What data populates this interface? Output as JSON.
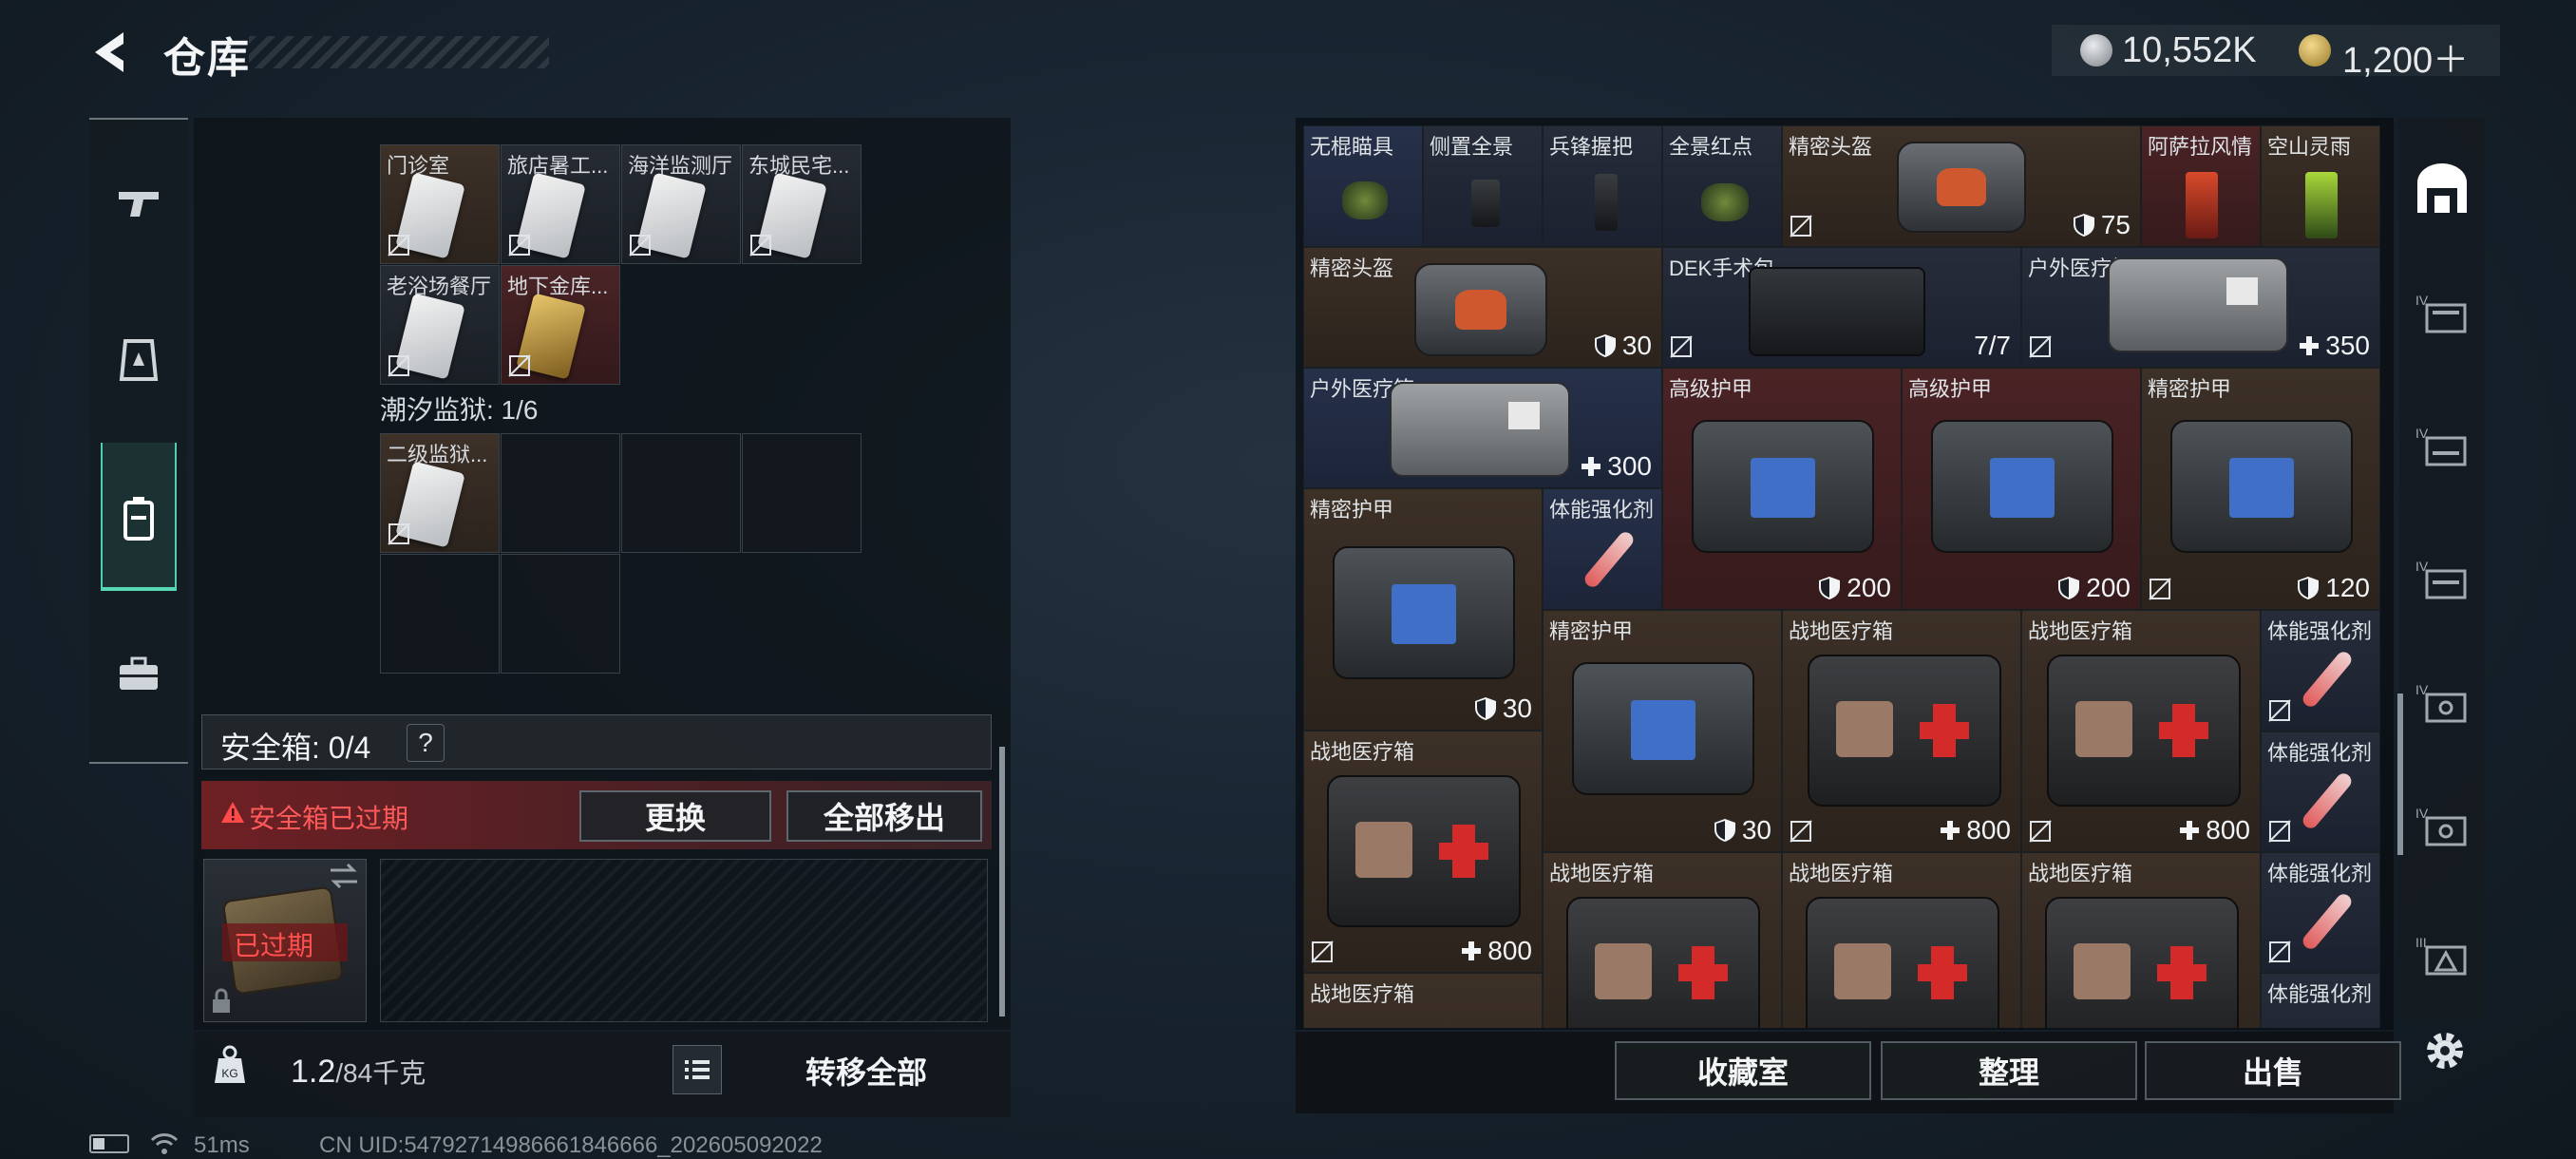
{
  "header": {
    "title": "仓库",
    "currency_1": "10,552K",
    "currency_2": "1,200＋"
  },
  "left_panel": {
    "row1": [
      "门诊室",
      "旅店暑工...",
      "海洋监测厅",
      "东城民宅..."
    ],
    "row2": [
      "老浴场餐厅",
      "地下金库..."
    ],
    "prison_label": "潮汐监狱: 1/6",
    "prison_items": [
      "二级监狱..."
    ],
    "safe_box_label": "安全箱: 0/4",
    "safe_help": "?",
    "safe_expired_text": "安全箱已过期",
    "replace_button": "更换",
    "remove_all_button": "全部移出",
    "safe_box_expired": "已过期",
    "weight_value": "1.2",
    "weight_max": "/84千克",
    "transfer_all_button": "转移全部"
  },
  "status_bar": {
    "ping": "51ms",
    "uid": "CN UID:54792714986661846666_202605092022"
  },
  "grid": {
    "cells": [
      {
        "label": "无棍瞄具",
        "value": ""
      },
      {
        "label": "侧置全景",
        "value": ""
      },
      {
        "label": "兵锋握把",
        "value": ""
      },
      {
        "label": "全景红点",
        "value": ""
      },
      {
        "label": "精密头盔",
        "value": "75"
      },
      {
        "label": "阿萨拉风情",
        "value": ""
      },
      {
        "label": "空山灵雨",
        "value": ""
      },
      {
        "label": "精密头盔",
        "value": "30"
      },
      {
        "label": "DEK手术包",
        "value": "7/7"
      },
      {
        "label": "户外医疗箱",
        "value": "350"
      },
      {
        "label": "户外医疗箱",
        "value": "300"
      },
      {
        "label": "高级护甲",
        "value": "200"
      },
      {
        "label": "高级护甲",
        "value": "200"
      },
      {
        "label": "精密护甲",
        "value": "120"
      },
      {
        "label": "精密护甲",
        "value": "30"
      },
      {
        "label": "体能强化剂",
        "value": ""
      },
      {
        "label": "精密护甲",
        "value": "30"
      },
      {
        "label": "战地医疗箱",
        "value": "800"
      },
      {
        "label": "战地医疗箱",
        "value": "800"
      },
      {
        "label": "体能强化剂",
        "value": ""
      },
      {
        "label": "战地医疗箱",
        "value": "800"
      },
      {
        "label": "体能强化剂",
        "value": ""
      },
      {
        "label": "战地医疗箱",
        "value": ""
      },
      {
        "label": "战地医疗箱",
        "value": ""
      },
      {
        "label": "战地医疗箱",
        "value": ""
      },
      {
        "label": "体能强化剂",
        "value": ""
      },
      {
        "label": "战地医疗箱",
        "value": ""
      },
      {
        "label": "体能强化剂",
        "value": ""
      }
    ]
  },
  "bottom_right": {
    "collection": "收藏室",
    "sort": "整理",
    "sell": "出售"
  }
}
